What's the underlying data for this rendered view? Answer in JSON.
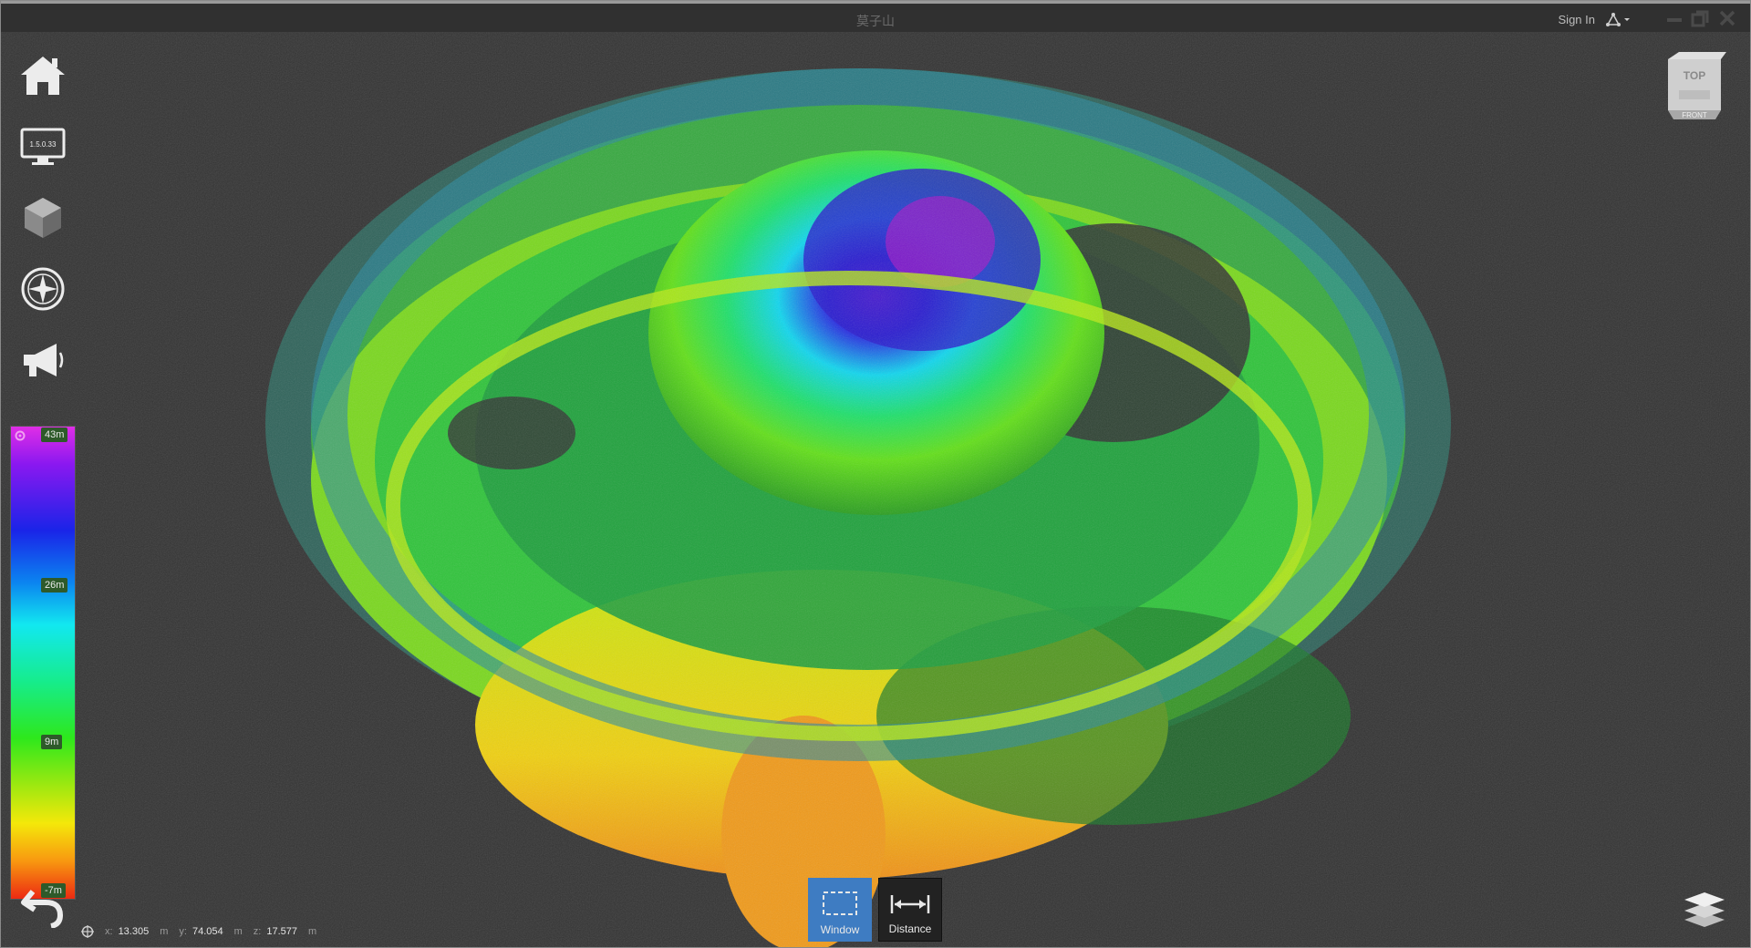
{
  "titlebar": {
    "title": "莫子山",
    "sign_in": "Sign In"
  },
  "sidebar": {
    "items": [
      {
        "name": "home-icon"
      },
      {
        "name": "monitor-icon",
        "version": "1.5.0.33"
      },
      {
        "name": "cube-icon"
      },
      {
        "name": "compass-icon"
      },
      {
        "name": "megaphone-icon"
      }
    ]
  },
  "legend": {
    "max": "43m",
    "mid_high": "26m",
    "mid_low": "9m",
    "min": "-7m",
    "colors": [
      "#e02ee6",
      "#1a24e8",
      "#12e8f0",
      "#2ee81c",
      "#f4e80a",
      "#ec2a12"
    ]
  },
  "viewcube": {
    "top": "TOP",
    "front": "FRONT"
  },
  "coords": {
    "x_label": "x:",
    "x_value": "13.305",
    "x_unit": "m",
    "y_label": "y:",
    "y_value": "74.054",
    "y_unit": "m",
    "z_label": "z:",
    "z_value": "17.577",
    "z_unit": "m"
  },
  "toolbar": {
    "window_label": "Window",
    "distance_label": "Distance"
  },
  "colors": {
    "background": "#333333",
    "accent": "#3e7cc2"
  }
}
